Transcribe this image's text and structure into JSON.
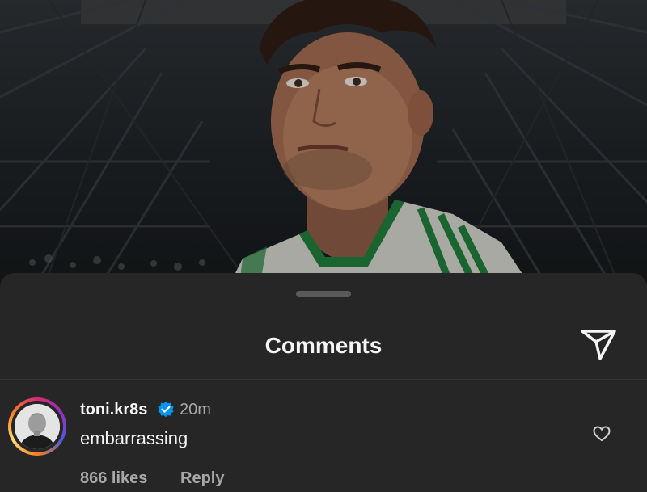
{
  "sheet": {
    "title": "Comments"
  },
  "comment": {
    "username": "toni.kr8s",
    "verified": true,
    "time": "20m",
    "text": "embarrassing",
    "likes": "866 likes",
    "reply_label": "Reply"
  },
  "icons": {
    "share": "paper-plane-icon",
    "verified": "verified-badge-icon",
    "like": "heart-outline-icon"
  },
  "colors": {
    "sheet_bg": "#262626",
    "text_primary": "#f5f5f5",
    "text_secondary": "#a8a8a8",
    "verified_blue": "#0095f6",
    "jersey_green": "#1f7a3a"
  }
}
